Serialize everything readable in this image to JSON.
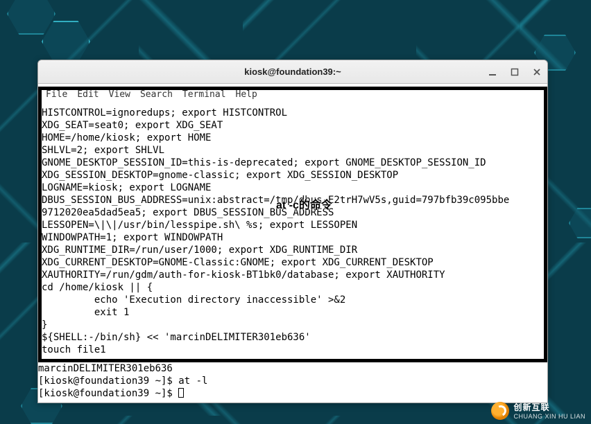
{
  "window": {
    "title": "kiosk@foundation39:~",
    "controls": {
      "minimize": "minimize-icon",
      "maximize": "maximize-icon",
      "close": "close-icon"
    }
  },
  "menubar": {
    "file": "File",
    "edit": "Edit",
    "view": "View",
    "search": "Search",
    "terminal": "Terminal",
    "help": "Help"
  },
  "overlay": {
    "label": "at -c的命令"
  },
  "terminal": {
    "inner_lines": "HISTCONTROL=ignoredups; export HISTCONTROL\nXDG_SEAT=seat0; export XDG_SEAT\nHOME=/home/kiosk; export HOME\nSHLVL=2; export SHLVL\nGNOME_DESKTOP_SESSION_ID=this-is-deprecated; export GNOME_DESKTOP_SESSION_ID\nXDG_SESSION_DESKTOP=gnome-classic; export XDG_SESSION_DESKTOP\nLOGNAME=kiosk; export LOGNAME\nDBUS_SESSION_BUS_ADDRESS=unix:abstract=/tmp/dbus-E2trH7wV5s,guid=797bfb39c095bbe\n9712020ea5dad5ea5; export DBUS_SESSION_BUS_ADDRESS\nLESSOPEN=\\|\\|/usr/bin/lesspipe.sh\\ %s; export LESSOPEN\nWINDOWPATH=1; export WINDOWPATH\nXDG_RUNTIME_DIR=/run/user/1000; export XDG_RUNTIME_DIR\nXDG_CURRENT_DESKTOP=GNOME-Classic:GNOME; export XDG_CURRENT_DESKTOP\nXAUTHORITY=/run/gdm/auth-for-kiosk-BT1bk0/database; export XAUTHORITY\ncd /home/kiosk || {\n         echo 'Execution directory inaccessible' >&2\n         exit 1\n}\n${SHELL:-/bin/sh} << 'marcinDELIMITER301eb636'\ntouch file1",
    "outer_lines": "marcinDELIMITER301eb636\n[kiosk@foundation39 ~]$ at -l\n[kiosk@foundation39 ~]$ "
  },
  "brand": {
    "line1": "创新互联",
    "line2": "CHUANG XIN HU LIAN"
  }
}
